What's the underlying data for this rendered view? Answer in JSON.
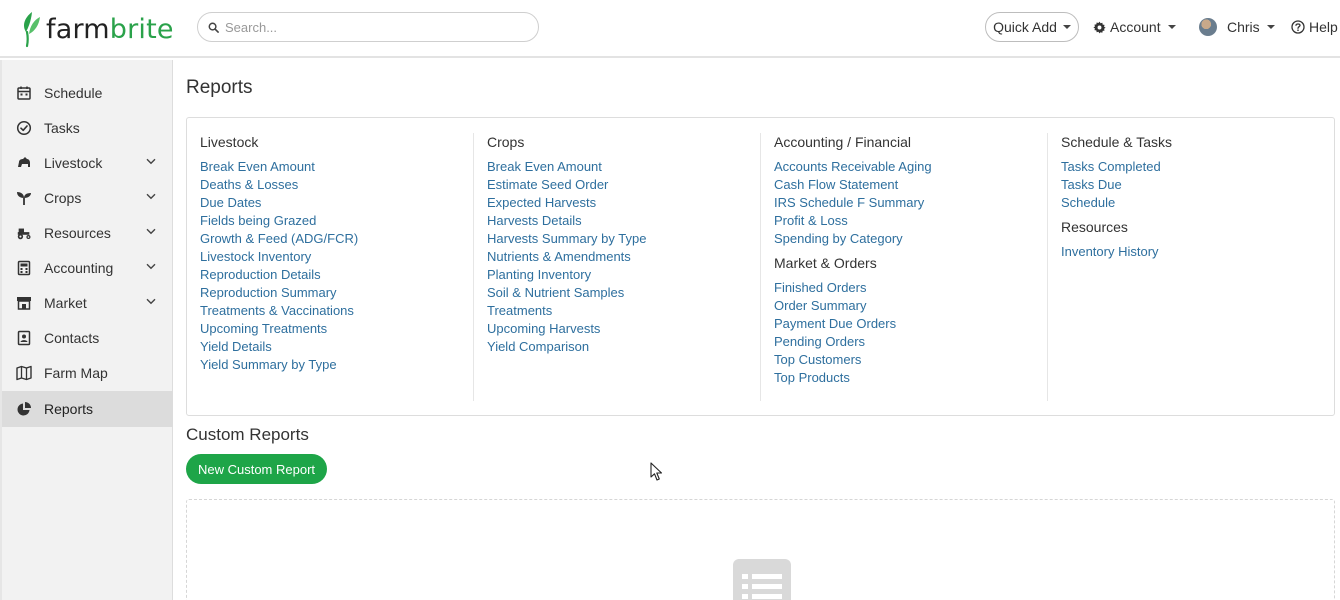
{
  "brand": {
    "name_part1": "farm",
    "name_part2": "brite",
    "accent": "#2aa24a"
  },
  "header": {
    "search_placeholder": "Search...",
    "quick_add": "Quick Add",
    "account": "Account",
    "user": "Chris",
    "help": "Help"
  },
  "sidebar": {
    "items": [
      {
        "label": "Schedule",
        "icon": "calendar-icon"
      },
      {
        "label": "Tasks",
        "icon": "check-circle-icon"
      },
      {
        "label": "Livestock",
        "icon": "livestock-icon",
        "expandable": true
      },
      {
        "label": "Crops",
        "icon": "sprout-icon",
        "expandable": true
      },
      {
        "label": "Resources",
        "icon": "tractor-icon",
        "expandable": true
      },
      {
        "label": "Accounting",
        "icon": "calculator-icon",
        "expandable": true
      },
      {
        "label": "Market",
        "icon": "store-icon",
        "expandable": true
      },
      {
        "label": "Contacts",
        "icon": "contact-book-icon"
      },
      {
        "label": "Farm Map",
        "icon": "map-icon"
      },
      {
        "label": "Reports",
        "icon": "pie-chart-icon",
        "active": true
      }
    ]
  },
  "main": {
    "title": "Reports",
    "columns": [
      {
        "sections": [
          {
            "heading": "Livestock",
            "links": [
              "Break Even Amount",
              "Deaths & Losses",
              "Due Dates",
              "Fields being Grazed",
              "Growth & Feed (ADG/FCR)",
              "Livestock Inventory",
              "Reproduction Details",
              "Reproduction Summary",
              "Treatments & Vaccinations",
              "Upcoming Treatments",
              "Yield Details",
              "Yield Summary by Type"
            ]
          }
        ]
      },
      {
        "sections": [
          {
            "heading": "Crops",
            "links": [
              "Break Even Amount",
              "Estimate Seed Order",
              "Expected Harvests",
              "Harvests Details",
              "Harvests Summary by Type",
              "Nutrients & Amendments",
              "Planting Inventory",
              "Soil & Nutrient Samples",
              "Treatments",
              "Upcoming Harvests",
              "Yield Comparison"
            ]
          }
        ]
      },
      {
        "sections": [
          {
            "heading": "Accounting / Financial",
            "links": [
              "Accounts Receivable Aging",
              "Cash Flow Statement",
              "IRS Schedule F Summary",
              "Profit & Loss",
              "Spending by Category"
            ]
          },
          {
            "heading": "Market & Orders",
            "links": [
              "Finished Orders",
              "Order Summary",
              "Payment Due Orders",
              "Pending Orders",
              "Top Customers",
              "Top Products"
            ]
          }
        ]
      },
      {
        "sections": [
          {
            "heading": "Schedule & Tasks",
            "links": [
              "Tasks Completed",
              "Tasks Due",
              "Schedule"
            ]
          },
          {
            "heading": "Resources",
            "links": [
              "Inventory History"
            ]
          }
        ]
      }
    ],
    "custom_reports": {
      "title": "Custom Reports",
      "new_button": "New Custom Report"
    }
  },
  "colors": {
    "link": "#2e6f9e",
    "button_green": "#1ea548",
    "sidebar_bg": "#f2f2f2",
    "sidebar_active": "#dcdcdc"
  }
}
